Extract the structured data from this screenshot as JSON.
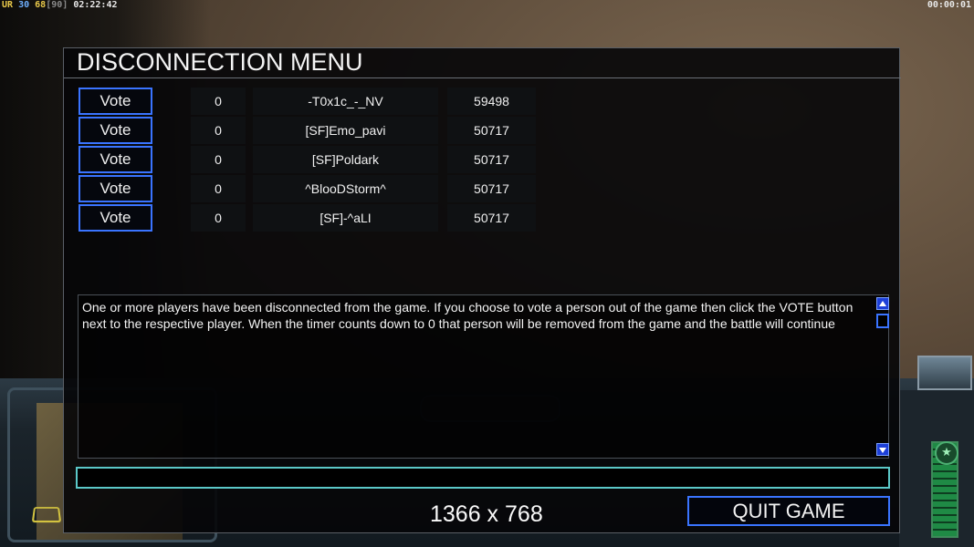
{
  "hud": {
    "ur_label": "UR",
    "ur_value": "30",
    "fps": "68",
    "fps_bracket": "[90]",
    "clock": "02:22:42",
    "timer": "00:00:01"
  },
  "dialog": {
    "title": "DISCONNECTION MENU",
    "players": [
      {
        "vote_label": "Vote",
        "votes": "0",
        "name": "-T0x1c_-_NV",
        "score": "59498"
      },
      {
        "vote_label": "Vote",
        "votes": "0",
        "name": "[SF]Emo_pavi",
        "score": "50717"
      },
      {
        "vote_label": "Vote",
        "votes": "0",
        "name": "[SF]Poldark",
        "score": "50717"
      },
      {
        "vote_label": "Vote",
        "votes": "0",
        "name": "^BlooDStorm^",
        "score": "50717"
      },
      {
        "vote_label": "Vote",
        "votes": "0",
        "name": "[SF]-^aLI",
        "score": "50717"
      }
    ],
    "message": "One or more players have been disconnected from the game. If you choose to vote a person out of the game then click the VOTE button next to the respective player. When the timer counts down to 0 that person will be removed from the game and the battle will continue",
    "chat_value": "",
    "resolution": "1366 x 768",
    "quit_label": "QUIT GAME"
  },
  "colors": {
    "button_border": "#3a74ff",
    "chat_border": "#5bc8c8",
    "scroll_button": "#1d3fd8"
  }
}
